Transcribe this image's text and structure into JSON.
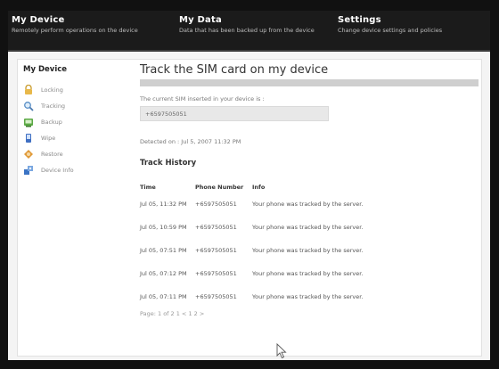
{
  "nav": [
    {
      "title": "My Device",
      "desc": "Remotely perform operations on the device"
    },
    {
      "title": "My Data",
      "desc": "Data that has been backed up from the device"
    },
    {
      "title": "Settings",
      "desc": "Change device settings and policies"
    }
  ],
  "sidebar": {
    "title": "My Device",
    "items": [
      {
        "label": "Locking",
        "icon": "lock-icon"
      },
      {
        "label": "Tracking",
        "icon": "magnifier-icon"
      },
      {
        "label": "Backup",
        "icon": "backup-icon"
      },
      {
        "label": "Wipe",
        "icon": "wipe-icon"
      },
      {
        "label": "Restore",
        "icon": "restore-icon"
      },
      {
        "label": "Device Info",
        "icon": "device-info-icon"
      }
    ]
  },
  "main": {
    "title": "Track the SIM card on my device",
    "sim_label": "The current SIM inserted in your device is :",
    "sim_value": "+6597505051",
    "detected": "Detected on : Jul 5, 2007 11:32 PM",
    "history_title": "Track History",
    "columns": [
      "Time",
      "Phone Number",
      "Info"
    ],
    "rows": [
      {
        "time": "Jul 05, 11:32 PM",
        "phone": "+6597505051",
        "info": "Your phone was tracked by the server."
      },
      {
        "time": "Jul 05, 10:59 PM",
        "phone": "+6597505051",
        "info": "Your phone was tracked by the server."
      },
      {
        "time": "Jul 05, 07:51 PM",
        "phone": "+6597505051",
        "info": "Your phone was tracked by the server."
      },
      {
        "time": "Jul 05, 07:12 PM",
        "phone": "+6597505051",
        "info": "Your phone was tracked by the server."
      },
      {
        "time": "Jul 05, 07:11 PM",
        "phone": "+6597505051",
        "info": "Your phone was tracked by the server."
      }
    ],
    "pager": "Page: 1 of 2 1 < 1 2 >"
  }
}
